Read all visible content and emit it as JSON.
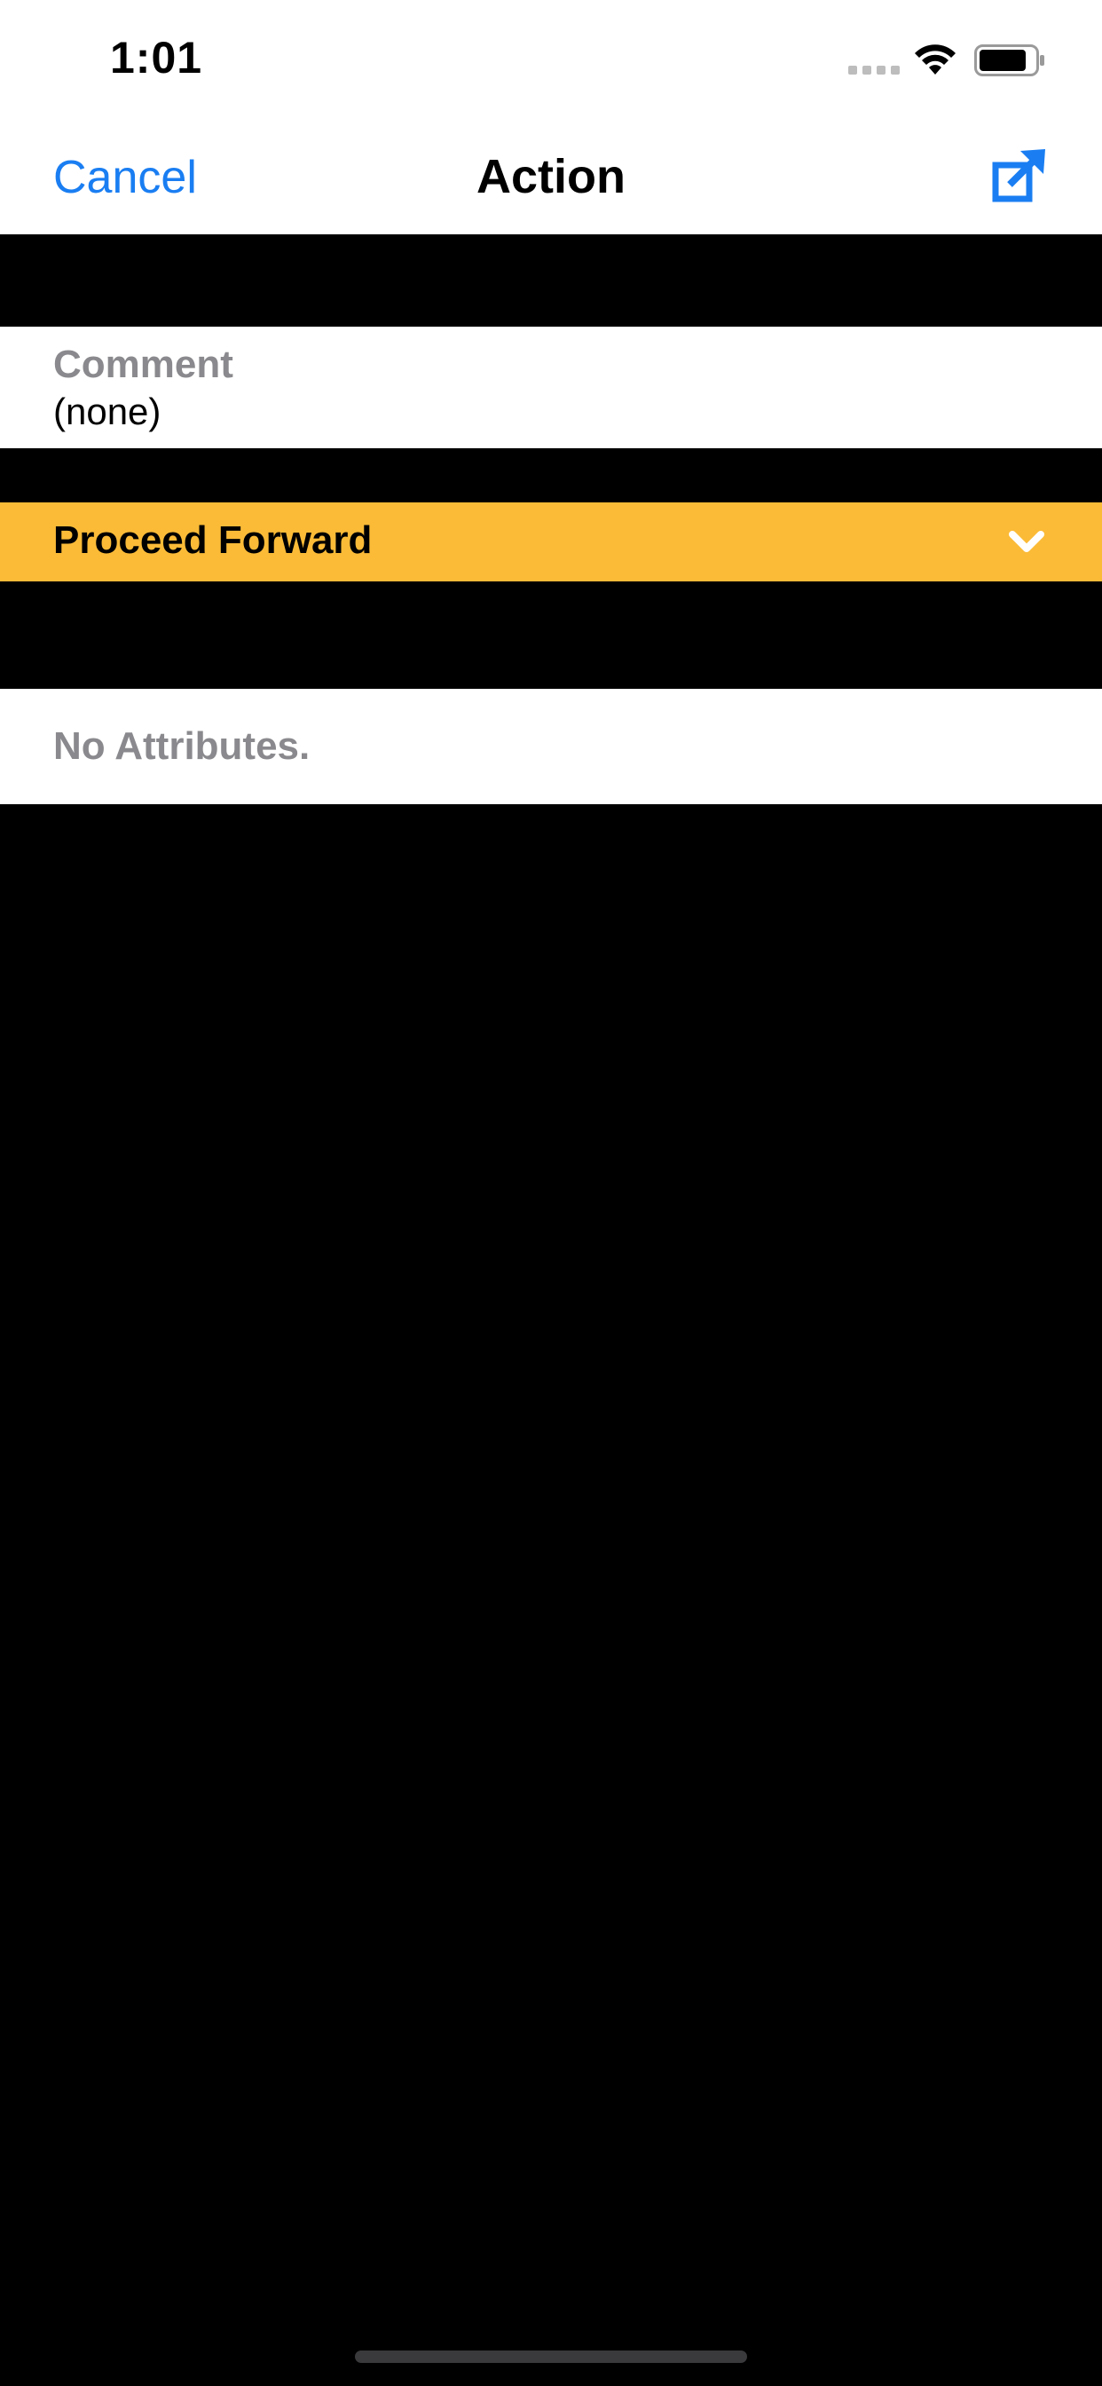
{
  "status_bar": {
    "time": "1:01"
  },
  "nav": {
    "cancel_label": "Cancel",
    "title": "Action",
    "export_icon": "export-icon"
  },
  "comment": {
    "label": "Comment",
    "value": "(none)"
  },
  "action": {
    "selected": "Proceed Forward",
    "icon": "chevron-down-icon"
  },
  "attributes": {
    "empty_text": "No Attributes."
  },
  "colors": {
    "accent": "#1a7ef2",
    "action_bar": "#fbbb37",
    "secondary_text": "#8a8a8e",
    "background": "#000000"
  }
}
